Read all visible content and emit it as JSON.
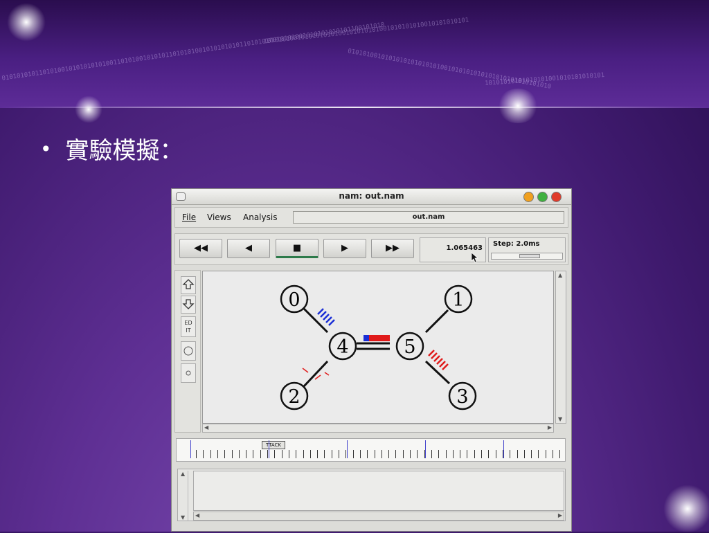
{
  "slide": {
    "bullet_text": "實驗模擬："
  },
  "window": {
    "title": "nam: out.nam",
    "menu": {
      "file": "File",
      "views": "Views",
      "analysis": "Analysis",
      "filename": "out.nam"
    },
    "controls": {
      "rewind": "◀◀",
      "back": "◀",
      "stop": "■",
      "play": "▶",
      "fastforward": "▶▶",
      "time": "1.065463",
      "step_label": "Step: 2.0ms",
      "step_level": 0.55
    },
    "tools": {
      "zoom_in_icon": "zoom-in-icon",
      "zoom_out_icon": "zoom-out-icon",
      "edit_label": "ED IT",
      "circle_large_icon": "circle-icon",
      "circle_small_icon": "small-circle-icon"
    },
    "topology": {
      "nodes": [
        {
          "id": "0"
        },
        {
          "id": "1"
        },
        {
          "id": "2"
        },
        {
          "id": "3"
        },
        {
          "id": "4"
        },
        {
          "id": "5"
        }
      ]
    },
    "timeline": {
      "marker_label": "TTACK"
    },
    "colors": {
      "packet_blue": "#1a2ed6",
      "packet_red": "#e01a1a",
      "play_indicator": "#2d7a4a"
    }
  }
}
